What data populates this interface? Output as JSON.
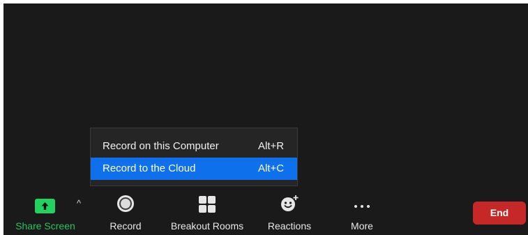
{
  "record_menu": {
    "items": [
      {
        "label": "Record on this Computer",
        "shortcut": "Alt+R",
        "highlighted": false
      },
      {
        "label": "Record to the Cloud",
        "shortcut": "Alt+C",
        "highlighted": true
      }
    ]
  },
  "toolbar": {
    "share_screen": {
      "label": "Share Screen",
      "icon": "share-screen-arrow-icon",
      "color": "#23d160",
      "caret": "^"
    },
    "record": {
      "label": "Record",
      "icon": "record-icon"
    },
    "breakout_rooms": {
      "label": "Breakout Rooms",
      "icon": "grid-icon"
    },
    "reactions": {
      "label": "Reactions",
      "icon": "smiley-plus-icon"
    },
    "more": {
      "label": "More",
      "icon": "ellipsis-icon"
    },
    "end": {
      "label": "End",
      "color": "#c62828"
    }
  },
  "colors": {
    "background": "#1a1a1a",
    "menu_highlight": "#0e71eb"
  }
}
